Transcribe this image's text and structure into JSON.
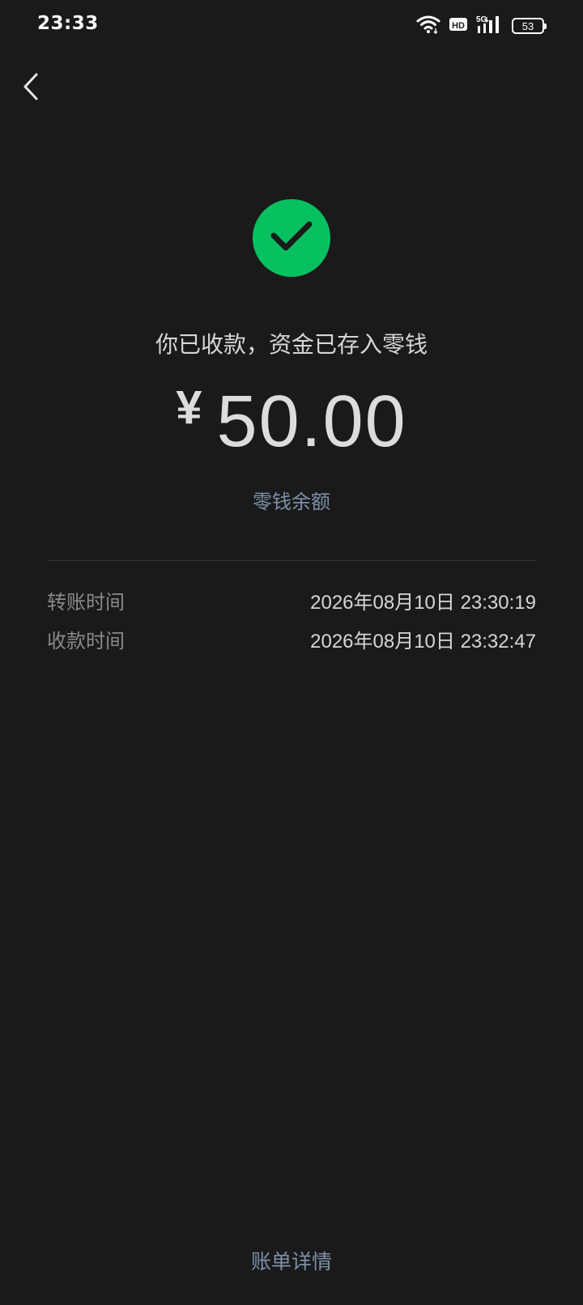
{
  "status_bar": {
    "time": "23:33",
    "battery_level": "53",
    "network_label": "5G",
    "hd_label": "HD",
    "icons": [
      "wifi-icon",
      "hd-icon",
      "5g-signal-icon",
      "battery-icon"
    ]
  },
  "navigation": {
    "back_icon": "chevron-left-icon"
  },
  "receipt": {
    "status_icon": "checkmark-icon",
    "status_color": "#07c160",
    "message": "你已收款，资金已存入零钱",
    "currency_symbol": "¥",
    "amount": "50.00",
    "balance_link": "零钱余额"
  },
  "details": [
    {
      "label": "转账时间",
      "value": "2026年08月10日 23:30:19"
    },
    {
      "label": "收款时间",
      "value": "2026年08月10日 23:32:47"
    }
  ],
  "footer": {
    "bill_details_link": "账单详情"
  },
  "colors": {
    "background": "#1a1a1a",
    "accent_green": "#07c160",
    "link_blue": "#7d90a9"
  }
}
